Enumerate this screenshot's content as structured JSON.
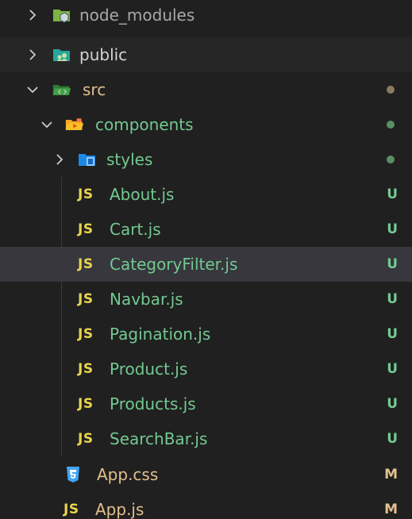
{
  "colors": {
    "background": "#202020",
    "selected_row": "#37373d",
    "untracked_green": "#73c991",
    "modified_amber": "#e2c08d",
    "js_yellow": "#e8d44d"
  },
  "tree": {
    "node_modules": {
      "label": "node_modules",
      "icon": "nodejs-folder-icon"
    },
    "public": {
      "label": "public",
      "icon": "public-folder-icon"
    },
    "src": {
      "label": "src",
      "icon": "src-folder-icon"
    },
    "components": {
      "label": "components",
      "icon": "components-folder-icon"
    },
    "styles": {
      "label": "styles",
      "icon": "styles-folder-icon"
    },
    "files": [
      {
        "label": "About.js",
        "badge": "U",
        "icon_text": "JS"
      },
      {
        "label": "Cart.js",
        "badge": "U",
        "icon_text": "JS"
      },
      {
        "label": "CategoryFilter.js",
        "badge": "U",
        "icon_text": "JS"
      },
      {
        "label": "Navbar.js",
        "badge": "U",
        "icon_text": "JS"
      },
      {
        "label": "Pagination.js",
        "badge": "U",
        "icon_text": "JS"
      },
      {
        "label": "Product.js",
        "badge": "U",
        "icon_text": "JS"
      },
      {
        "label": "Products.js",
        "badge": "U",
        "icon_text": "JS"
      },
      {
        "label": "SearchBar.js",
        "badge": "U",
        "icon_text": "JS"
      }
    ],
    "app_css": {
      "label": "App.css",
      "badge": "M",
      "icon": "css3-icon"
    },
    "app_js": {
      "label": "App.js",
      "badge": "M",
      "icon_text": "JS"
    }
  }
}
